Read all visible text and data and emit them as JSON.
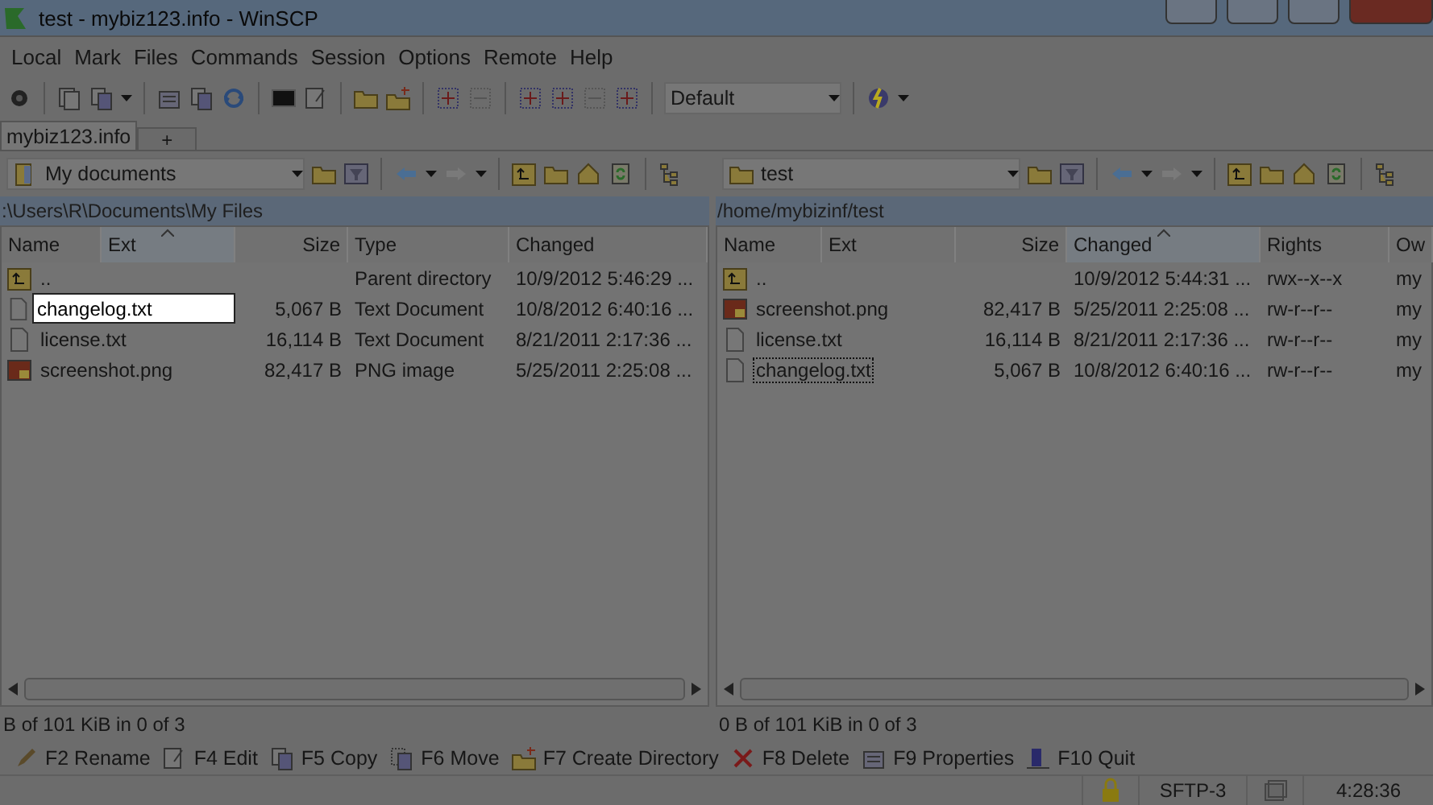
{
  "window": {
    "title": "test - mybiz123.info - WinSCP"
  },
  "menu": [
    "Local",
    "Mark",
    "Files",
    "Commands",
    "Session",
    "Options",
    "Remote",
    "Help"
  ],
  "toolbar": {
    "preset": "Default"
  },
  "tabs": [
    {
      "label": "mybiz123.info",
      "selected": true
    },
    {
      "label": "+",
      "selected": false
    }
  ],
  "panels": [
    {
      "location": "My documents",
      "path": ":\\Users\\R\\Documents\\My Files",
      "columns": [
        {
          "label": "Name",
          "sorted": false
        },
        {
          "label": "Ext",
          "sorted": true
        },
        {
          "label": "Size",
          "sorted": false
        },
        {
          "label": "Type",
          "sorted": false
        },
        {
          "label": "Changed",
          "sorted": false
        }
      ],
      "rows": [
        {
          "kind": "parent",
          "name": "..",
          "type": "Parent directory",
          "changed": "10/9/2012 5:46:29 ...",
          "editing": false,
          "focused": false
        },
        {
          "kind": "text",
          "name": "changelog.txt",
          "size": "5,067 B",
          "type": "Text Document",
          "changed": "10/8/2012 6:40:16 ...",
          "editing": true,
          "focused": false
        },
        {
          "kind": "text",
          "name": "license.txt",
          "size": "16,114 B",
          "type": "Text Document",
          "changed": "8/21/2011 2:17:36 ...",
          "editing": false,
          "focused": false
        },
        {
          "kind": "image",
          "name": "screenshot.png",
          "size": "82,417 B",
          "type": "PNG image",
          "changed": "5/25/2011 2:25:08 ...",
          "editing": false,
          "focused": false
        }
      ],
      "status": "B of 101 KiB in 0 of 3"
    },
    {
      "location": "test",
      "path": "/home/mybizinf/test",
      "columns": [
        {
          "label": "Name",
          "sorted": false
        },
        {
          "label": "Ext",
          "sorted": false
        },
        {
          "label": "Size",
          "sorted": false
        },
        {
          "label": "Changed",
          "sorted": true
        },
        {
          "label": "Rights",
          "sorted": false
        },
        {
          "label": "Ow",
          "sorted": false
        }
      ],
      "rows": [
        {
          "kind": "parent",
          "name": "..",
          "changed": "10/9/2012 5:44:31 ...",
          "rights": "rwx--x--x",
          "owner": "my",
          "editing": false,
          "focused": false
        },
        {
          "kind": "image",
          "name": "screenshot.png",
          "size": "82,417 B",
          "changed": "5/25/2011 2:25:08 ...",
          "rights": "rw-r--r--",
          "owner": "my",
          "editing": false,
          "focused": false
        },
        {
          "kind": "text",
          "name": "license.txt",
          "size": "16,114 B",
          "changed": "8/21/2011 2:17:36 ...",
          "rights": "rw-r--r--",
          "owner": "my",
          "editing": false,
          "focused": false
        },
        {
          "kind": "text",
          "name": "changelog.txt",
          "size": "5,067 B",
          "changed": "10/8/2012 6:40:16 ...",
          "rights": "rw-r--r--",
          "owner": "my",
          "editing": false,
          "focused": true
        }
      ],
      "status": "0 B of 101 KiB in 0 of 3"
    }
  ],
  "commands": [
    {
      "kind": "rename",
      "label": "F2 Rename"
    },
    {
      "kind": "edit",
      "label": "F4 Edit"
    },
    {
      "kind": "copy",
      "label": "F5 Copy"
    },
    {
      "kind": "move",
      "label": "F6 Move"
    },
    {
      "kind": "mkdir",
      "label": "F7 Create Directory"
    },
    {
      "kind": "delete",
      "label": "F8 Delete"
    },
    {
      "kind": "properties",
      "label": "F9 Properties"
    },
    {
      "kind": "quit",
      "label": "F10 Quit"
    }
  ],
  "status_bar": {
    "protocol": "SFTP-3",
    "time": "4:28:36"
  }
}
